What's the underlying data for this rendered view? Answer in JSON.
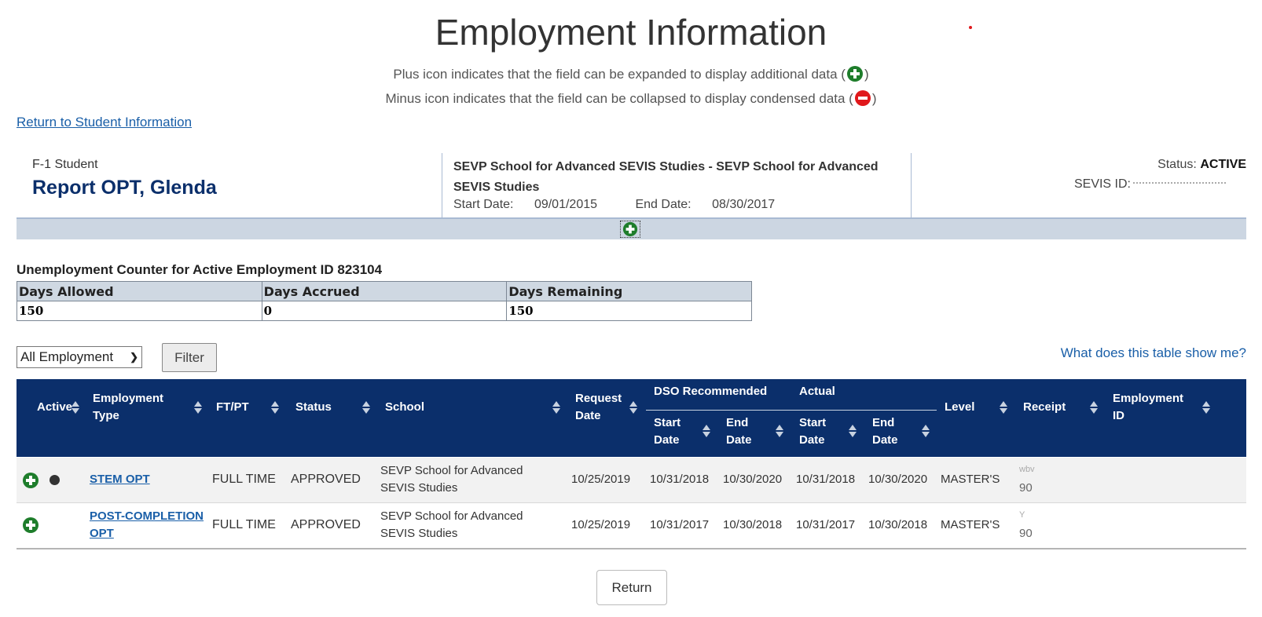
{
  "page": {
    "title": "Employment Information",
    "legend_plus": "Plus icon indicates that the field can be expanded to display additional data (",
    "legend_minus": "Minus icon indicates that the field can be collapsed to display condensed data (",
    "legend_close": ")",
    "return_link": "Return to Student Information"
  },
  "student": {
    "type": "F-1 Student",
    "name": "Report OPT, Glenda",
    "school": "SEVP School for Advanced SEVIS Studies - SEVP School for Advanced SEVIS Studies",
    "start_label": "Start Date:",
    "start_date": "09/01/2015",
    "end_label": "End Date:",
    "end_date": "08/30/2017",
    "status_label": "Status:",
    "status": "ACTIVE",
    "sevis_label": "SEVIS ID:"
  },
  "counter": {
    "title": "Unemployment Counter for Active Employment ID 823104",
    "headers": [
      "Days Allowed",
      "Days Accrued",
      "Days Remaining"
    ],
    "values": [
      "150",
      "0",
      "150"
    ]
  },
  "controls": {
    "select_value": "All Employment",
    "filter_label": "Filter",
    "help_link": "What does this table show me?",
    "return_label": "Return"
  },
  "table": {
    "headers": {
      "active": "Active",
      "employment_type": "Employment Type",
      "ftpt": "FT/PT",
      "status": "Status",
      "school": "School",
      "request_date": "Request Date",
      "dso_group": "DSO Recommended",
      "actual_group": "Actual",
      "start_date": "Start Date",
      "end_date": "End Date",
      "level": "Level",
      "receipt": "Receipt",
      "employment_id": "Employment ID"
    },
    "rows": [
      {
        "employment_type": "STEM OPT",
        "ftpt": "FULL TIME",
        "status": "APPROVED",
        "school": "SEVP School for Advanced SEVIS Studies",
        "request_date": "10/25/2019",
        "dso_start": "10/31/2018",
        "dso_end": "10/30/2020",
        "actual_start": "10/31/2018",
        "actual_end": "10/30/2020",
        "level": "MASTER'S",
        "receipt_a": "wbv",
        "receipt_b": "90"
      },
      {
        "employment_type": "POST-COMPLETION OPT",
        "ftpt": "FULL TIME",
        "status": "APPROVED",
        "school": "SEVP School for Advanced SEVIS Studies",
        "request_date": "10/25/2019",
        "dso_start": "10/31/2017",
        "dso_end": "10/30/2018",
        "actual_start": "10/31/2017",
        "actual_end": "10/30/2018",
        "level": "MASTER'S",
        "receipt_a": "Y",
        "receipt_b": "90"
      }
    ]
  },
  "colors": {
    "header_navy": "#0b2f6b",
    "link_blue": "#1a5fa8",
    "plus_green": "#1e7d2b",
    "minus_red": "#e0181b"
  }
}
